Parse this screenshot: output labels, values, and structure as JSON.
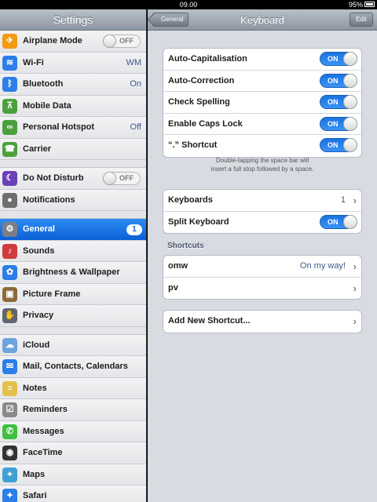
{
  "status": {
    "time": "09.00",
    "battery": "95%"
  },
  "sidebar": {
    "title": "Settings",
    "groups": [
      [
        {
          "icon": "airplane-icon",
          "glyph": "✈",
          "color": "#f29a12",
          "label": "Airplane Mode",
          "switch": "OFF"
        },
        {
          "icon": "wifi-icon",
          "glyph": "≋",
          "color": "#2c7ee8",
          "label": "Wi-Fi",
          "value": "WM"
        },
        {
          "icon": "bluetooth-icon",
          "glyph": "ᛒ",
          "color": "#2c7ee8",
          "label": "Bluetooth",
          "value": "On"
        },
        {
          "icon": "mobile-data-icon",
          "glyph": "⊼",
          "color": "#4aa13c",
          "label": "Mobile Data"
        },
        {
          "icon": "hotspot-icon",
          "glyph": "∞",
          "color": "#4aa13c",
          "label": "Personal Hotspot",
          "value": "Off"
        },
        {
          "icon": "carrier-icon",
          "glyph": "☎",
          "color": "#4aa13c",
          "label": "Carrier"
        }
      ],
      [
        {
          "icon": "moon-icon",
          "glyph": "☾",
          "color": "#6a3fb8",
          "label": "Do Not Disturb",
          "switch": "OFF"
        },
        {
          "icon": "notifications-icon",
          "glyph": "●",
          "color": "#6e6e6e",
          "label": "Notifications"
        }
      ],
      [
        {
          "icon": "gear-icon",
          "glyph": "⚙",
          "color": "#7a7f88",
          "label": "General",
          "badge": "1",
          "selected": true
        },
        {
          "icon": "sounds-icon",
          "glyph": "♪",
          "color": "#d23b3b",
          "label": "Sounds"
        },
        {
          "icon": "brightness-icon",
          "glyph": "✿",
          "color": "#2c7ee8",
          "label": "Brightness & Wallpaper"
        },
        {
          "icon": "picture-frame-icon",
          "glyph": "▣",
          "color": "#8c6a3a",
          "label": "Picture Frame"
        },
        {
          "icon": "privacy-icon",
          "glyph": "✋",
          "color": "#5f6670",
          "label": "Privacy"
        }
      ],
      [
        {
          "icon": "icloud-icon",
          "glyph": "☁",
          "color": "#6fa3dd",
          "label": "iCloud"
        },
        {
          "icon": "mail-icon",
          "glyph": "✉",
          "color": "#2c7ee8",
          "label": "Mail, Contacts, Calendars"
        },
        {
          "icon": "notes-icon",
          "glyph": "≡",
          "color": "#e3c04a",
          "label": "Notes"
        },
        {
          "icon": "reminders-icon",
          "glyph": "☑",
          "color": "#8a8a8a",
          "label": "Reminders"
        },
        {
          "icon": "messages-icon",
          "glyph": "✆",
          "color": "#3fbf3f",
          "label": "Messages"
        },
        {
          "icon": "facetime-icon",
          "glyph": "◉",
          "color": "#333333",
          "label": "FaceTime"
        },
        {
          "icon": "maps-icon",
          "glyph": "⌖",
          "color": "#3fa0d6",
          "label": "Maps"
        },
        {
          "icon": "safari-icon",
          "glyph": "✦",
          "color": "#2c7ee8",
          "label": "Safari"
        }
      ]
    ]
  },
  "main": {
    "title": "Keyboard",
    "back_label": "General",
    "edit_label": "Edit",
    "toggles": [
      {
        "label": "Auto-Capitalisation",
        "state": "ON"
      },
      {
        "label": "Auto-Correction",
        "state": "ON"
      },
      {
        "label": "Check Spelling",
        "state": "ON"
      },
      {
        "label": "Enable Caps Lock",
        "state": "ON"
      },
      {
        "label": "“.” Shortcut",
        "state": "ON"
      }
    ],
    "footnote": [
      "Double-tapping the space bar will",
      "insert a full stop followed by a space."
    ],
    "keyboards": {
      "label": "Keyboards",
      "value": "1"
    },
    "split": {
      "label": "Split Keyboard",
      "state": "ON"
    },
    "shortcuts_title": "Shortcuts",
    "shortcuts": [
      {
        "label": "omw",
        "value": "On my way!"
      },
      {
        "label": "pv",
        "value": ""
      }
    ],
    "add_shortcut": "Add New Shortcut..."
  }
}
